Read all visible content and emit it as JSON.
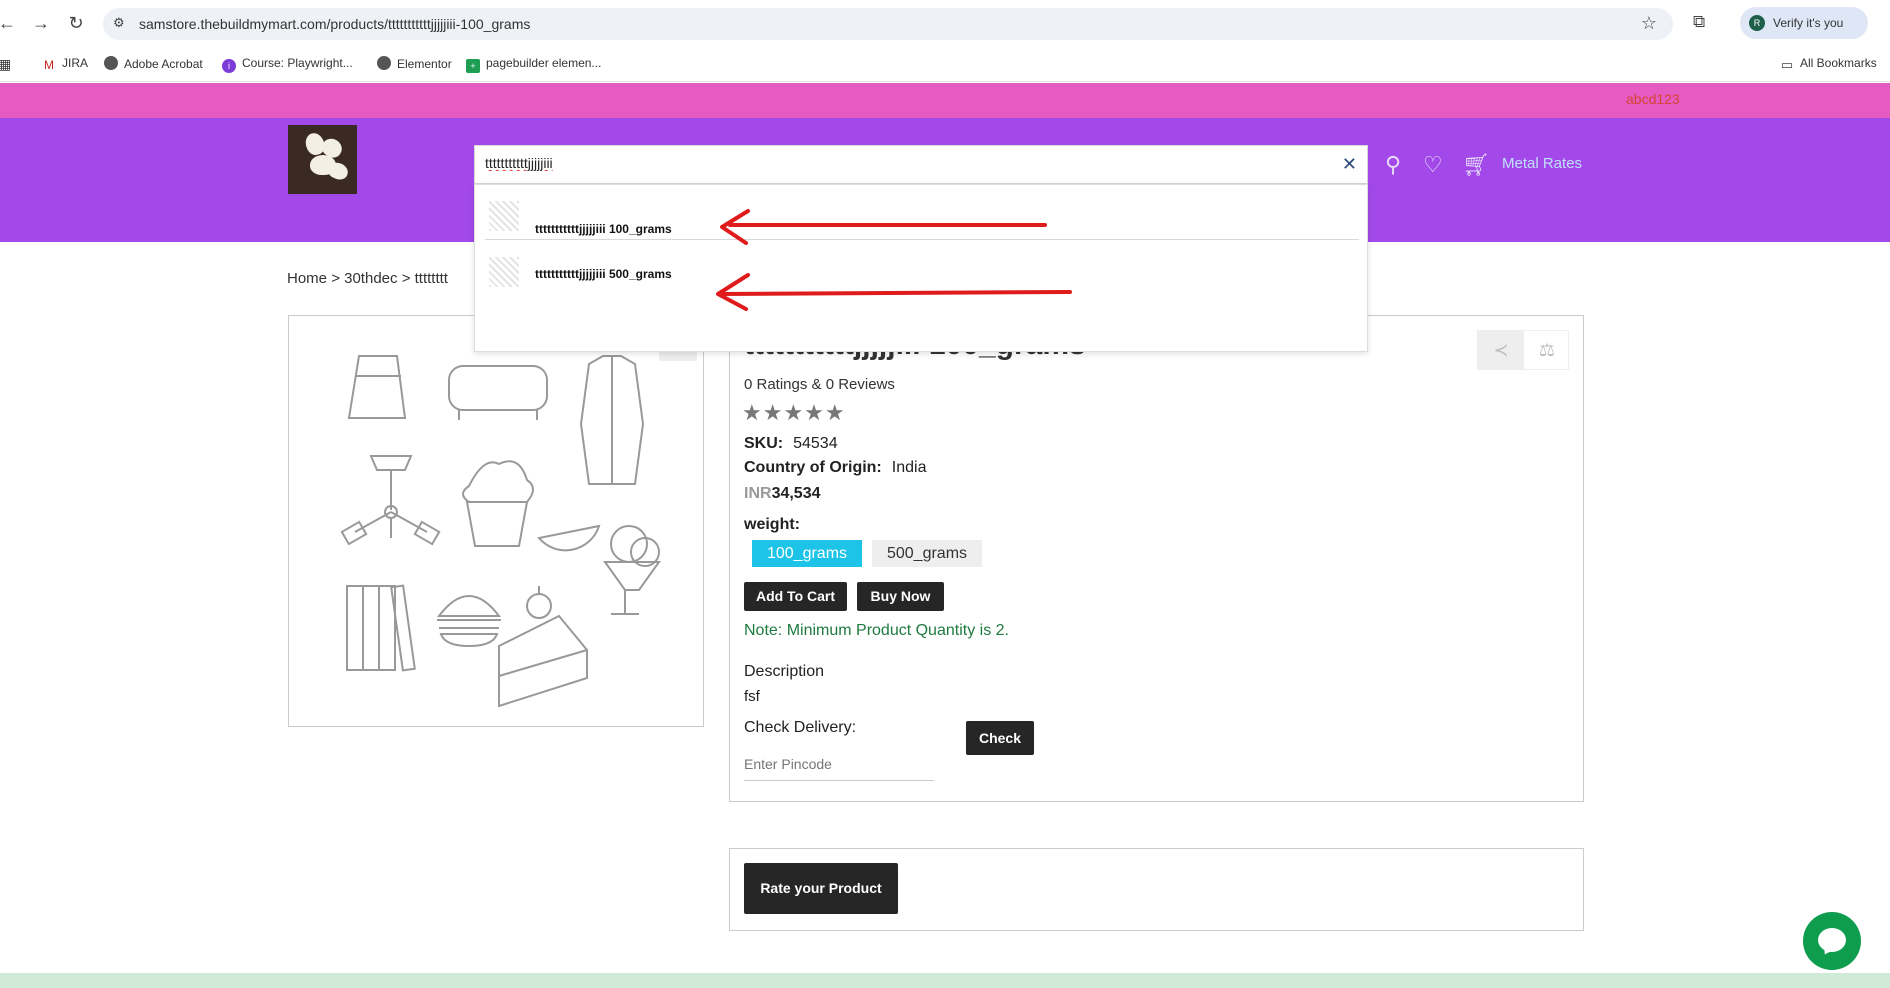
{
  "browser": {
    "url": "samstore.thebuildmymart.com/products/tttttttttttjjjjjiii-100_grams",
    "verify_label": "Verify it's you",
    "verify_initial": "R",
    "bookmarks": [
      "JIRA",
      "Adobe Acrobat",
      "Course: Playwright...",
      "Elementor",
      "pagebuilder elemen..."
    ],
    "all_bookmarks": "All Bookmarks"
  },
  "site": {
    "top_promo": "abcd123",
    "metal_rates": "Metal Rates",
    "colors": {
      "topbar": "#e65bc2",
      "header": "#a349ea",
      "weight_selected": "#1ec4e7",
      "note": "#1f7a3f"
    }
  },
  "search": {
    "value": "tttttttttttjjjjjiii",
    "clear_icon": "close-icon",
    "suggestions": [
      {
        "label": "tttttttttttjjjjjiii 100_grams"
      },
      {
        "label": "tttttttttttjjjjjiii 500_grams"
      }
    ]
  },
  "breadcrumb": {
    "home": "Home",
    "sep": ">",
    "category": "30thdec",
    "current": "tttttttt"
  },
  "product": {
    "title": "tttttttttttjjjjjiii 100_grams",
    "ratings_text": "0 Ratings & 0 Reviews",
    "stars": "★★★★★",
    "sku_label": "SKU:",
    "sku": "54534",
    "origin_label": "Country of Origin:",
    "origin": "India",
    "currency": "INR",
    "price": "34,534",
    "weight_label": "weight:",
    "weight_options": [
      "100_grams",
      "500_grams"
    ],
    "add_to_cart": "Add To Cart",
    "buy_now": "Buy Now",
    "note": "Note: Minimum Product Quantity is 2.",
    "description_label": "Description",
    "description": "fsf",
    "delivery_label": "Check Delivery:",
    "pincode_placeholder": "Enter Pincode",
    "check": "Check",
    "rate_button": "Rate your Product"
  }
}
